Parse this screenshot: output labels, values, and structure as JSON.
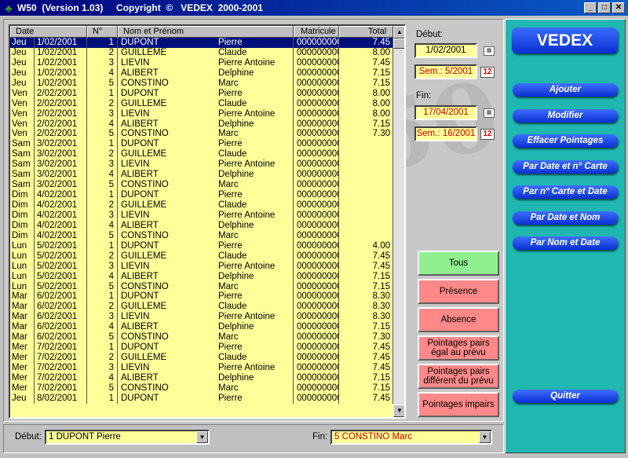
{
  "window": {
    "title": "W50  (Version 1.03)     Copyright  ©   VEDEX  2000-2001",
    "min": "_",
    "max": "□",
    "close": "✕"
  },
  "grid": {
    "headers": [
      "Date",
      "N°",
      "Nom et Prénom",
      "Matricule",
      "Total"
    ],
    "rows": [
      [
        "Jeu",
        "1/02/2001",
        "1",
        "DUPONT",
        "Pierre",
        "0000000001",
        "7.45"
      ],
      [
        "Jeu",
        "1/02/2001",
        "2",
        "GUILLEME",
        "Claude",
        "0000000002",
        "8.00"
      ],
      [
        "Jeu",
        "1/02/2001",
        "3",
        "LIEVIN",
        "Pierre Antoine",
        "0000000003",
        "7.45"
      ],
      [
        "Jeu",
        "1/02/2001",
        "4",
        "ALIBERT",
        "Delphine",
        "0000000004",
        "7.15"
      ],
      [
        "Jeu",
        "1/02/2001",
        "5",
        "CONSTINO",
        "Marc",
        "0000000005",
        "7.15"
      ],
      [
        "Ven",
        "2/02/2001",
        "1",
        "DUPONT",
        "Pierre",
        "0000000001",
        "8.00"
      ],
      [
        "Ven",
        "2/02/2001",
        "2",
        "GUILLEME",
        "Claude",
        "0000000002",
        "8.00"
      ],
      [
        "Ven",
        "2/02/2001",
        "3",
        "LIEVIN",
        "Pierre Antoine",
        "0000000003",
        "8.00"
      ],
      [
        "Ven",
        "2/02/2001",
        "4",
        "ALIBERT",
        "Delphine",
        "0000000004",
        "7.15"
      ],
      [
        "Ven",
        "2/02/2001",
        "5",
        "CONSTINO",
        "Marc",
        "0000000005",
        "7.30"
      ],
      [
        "Sam",
        "3/02/2001",
        "1",
        "DUPONT",
        "Pierre",
        "0000000001",
        ""
      ],
      [
        "Sam",
        "3/02/2001",
        "2",
        "GUILLEME",
        "Claude",
        "0000000002",
        ""
      ],
      [
        "Sam",
        "3/02/2001",
        "3",
        "LIEVIN",
        "Pierre Antoine",
        "0000000003",
        ""
      ],
      [
        "Sam",
        "3/02/2001",
        "4",
        "ALIBERT",
        "Delphine",
        "0000000004",
        ""
      ],
      [
        "Sam",
        "3/02/2001",
        "5",
        "CONSTINO",
        "Marc",
        "0000000005",
        ""
      ],
      [
        "Dim",
        "4/02/2001",
        "1",
        "DUPONT",
        "Pierre",
        "0000000001",
        ""
      ],
      [
        "Dim",
        "4/02/2001",
        "2",
        "GUILLEME",
        "Claude",
        "0000000002",
        ""
      ],
      [
        "Dim",
        "4/02/2001",
        "3",
        "LIEVIN",
        "Pierre Antoine",
        "0000000003",
        ""
      ],
      [
        "Dim",
        "4/02/2001",
        "4",
        "ALIBERT",
        "Delphine",
        "0000000004",
        ""
      ],
      [
        "Dim",
        "4/02/2001",
        "5",
        "CONSTINO",
        "Marc",
        "0000000005",
        ""
      ],
      [
        "Lun",
        "5/02/2001",
        "1",
        "DUPONT",
        "Pierre",
        "0000000001",
        "4.00"
      ],
      [
        "Lun",
        "5/02/2001",
        "2",
        "GUILLEME",
        "Claude",
        "0000000002",
        "7.45"
      ],
      [
        "Lun",
        "5/02/2001",
        "3",
        "LIEVIN",
        "Pierre Antoine",
        "0000000003",
        "7.45"
      ],
      [
        "Lun",
        "5/02/2001",
        "4",
        "ALIBERT",
        "Delphine",
        "0000000004",
        "7.15"
      ],
      [
        "Lun",
        "5/02/2001",
        "5",
        "CONSTINO",
        "Marc",
        "0000000005",
        "7.15"
      ],
      [
        "Mar",
        "6/02/2001",
        "1",
        "DUPONT",
        "Pierre",
        "0000000001",
        "8.30"
      ],
      [
        "Mar",
        "6/02/2001",
        "2",
        "GUILLEME",
        "Claude",
        "0000000002",
        "8.30"
      ],
      [
        "Mar",
        "6/02/2001",
        "3",
        "LIEVIN",
        "Pierre Antoine",
        "0000000003",
        "8.30"
      ],
      [
        "Mar",
        "6/02/2001",
        "4",
        "ALIBERT",
        "Delphine",
        "0000000004",
        "7.15"
      ],
      [
        "Mar",
        "6/02/2001",
        "5",
        "CONSTINO",
        "Marc",
        "0000000005",
        "7.30"
      ],
      [
        "Mer",
        "7/02/2001",
        "1",
        "DUPONT",
        "Pierre",
        "0000000001",
        "7.45"
      ],
      [
        "Mer",
        "7/02/2001",
        "2",
        "GUILLEME",
        "Claude",
        "0000000002",
        "7.45"
      ],
      [
        "Mer",
        "7/02/2001",
        "3",
        "LIEVIN",
        "Pierre Antoine",
        "0000000003",
        "7.45"
      ],
      [
        "Mer",
        "7/02/2001",
        "4",
        "ALIBERT",
        "Delphine",
        "0000000004",
        "7.15"
      ],
      [
        "Mer",
        "7/02/2001",
        "5",
        "CONSTINO",
        "Marc",
        "0000000005",
        "7.15"
      ],
      [
        "Jeu",
        "8/02/2001",
        "1",
        "DUPONT",
        "Pierre",
        "0000000001",
        "7.45"
      ]
    ]
  },
  "filters": {
    "debut_label": "Début:",
    "debut_date": "1/02/2001",
    "debut_sem": "Sem.: 5/2001",
    "fin_label": "Fin:",
    "fin_date": "17/04/2001",
    "fin_sem": "Sem.: 16/2001",
    "week_icon": "12"
  },
  "filter_buttons": {
    "tous": "Tous",
    "presence": "Présence",
    "absence": "Absence",
    "pairs_egal": "Pointages pairs égal au prévu",
    "pairs_diff": "Pointages pairs différent du prévu",
    "impairs": "Pointages impairs"
  },
  "sidebar": {
    "brand": "VEDEX",
    "ajouter": "Ajouter",
    "modifier": "Modifier",
    "effacer": "Effacer Pointages",
    "date_carte": "Par Date et n° Carte",
    "carte_date": "Par n° Carte et Date",
    "date_nom": "Par Date et Nom",
    "nom_date": "Par Nom et Date",
    "quitter": "Quitter"
  },
  "bottom": {
    "debut_label": "Début:",
    "debut_value": "1 DUPONT Pierre",
    "fin_label": "Fin:",
    "fin_value": "5 CONSTINO Marc"
  },
  "colors": {
    "grid_bg": "#ffff99",
    "sidebar_bg": "#1fb7b0",
    "pill": "#0a2fd0",
    "selected": "#00107b"
  }
}
